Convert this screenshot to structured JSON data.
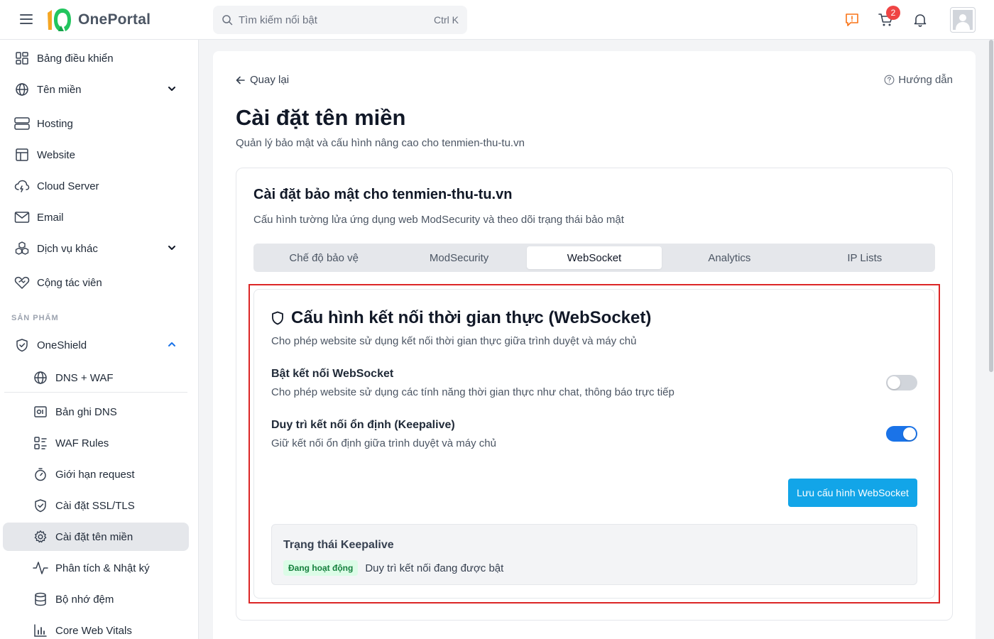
{
  "app": {
    "name": "OnePortal",
    "search_placeholder": "Tìm kiếm nổi bật",
    "search_shortcut": "Ctrl K",
    "cart_count": "2",
    "brand_color": "#12a5e8"
  },
  "sidebar": {
    "items": [
      {
        "label": "Bảng điều khiển",
        "icon": "dashboard-icon"
      },
      {
        "label": "Tên miền",
        "icon": "globe-icon"
      },
      {
        "label": "Hosting",
        "icon": "server-icon"
      },
      {
        "label": "Website",
        "icon": "website-icon"
      },
      {
        "label": "Cloud Server",
        "icon": "cloud-icon"
      },
      {
        "label": "Email",
        "icon": "mail-icon"
      },
      {
        "label": "Dịch vụ khác",
        "icon": "boxes-icon"
      },
      {
        "label": "Cộng tác viên",
        "icon": "handshake-heart-icon"
      }
    ],
    "section_label": "SẢN PHẨM",
    "product": {
      "label": "OneShield",
      "icon": "shield-icon"
    },
    "sub_items": [
      {
        "label": "DNS + WAF",
        "icon": "globe-icon"
      },
      {
        "label": "Bản ghi DNS",
        "icon": "dns-record-icon"
      },
      {
        "label": "WAF Rules",
        "icon": "rules-icon"
      },
      {
        "label": "Giới hạn request",
        "icon": "timer-icon"
      },
      {
        "label": "Cài đặt SSL/TLS",
        "icon": "shield-check-icon"
      },
      {
        "label": "Cài đặt tên miền",
        "icon": "gear-icon"
      },
      {
        "label": "Phân tích & Nhật ký",
        "icon": "activity-icon"
      },
      {
        "label": "Bộ nhớ đệm",
        "icon": "database-icon"
      },
      {
        "label": "Core Web Vitals",
        "icon": "bar-chart-icon"
      }
    ]
  },
  "main": {
    "back_label": "Quay lại",
    "guide_label": "Hướng dẫn",
    "title": "Cài đặt tên miền",
    "subtitle": "Quản lý bảo mật và cấu hình nâng cao cho tenmien-thu-tu.vn",
    "card": {
      "title": "Cài đặt bảo mật cho tenmien-thu-tu.vn",
      "subtitle": "Cấu hình tường lửa ứng dụng web ModSecurity và theo dõi trạng thái bảo mật",
      "tabs": [
        {
          "label": "Chế độ bảo vệ"
        },
        {
          "label": "ModSecurity"
        },
        {
          "label": "WebSocket"
        },
        {
          "label": "Analytics"
        },
        {
          "label": "IP Lists"
        }
      ],
      "active_tab": "WebSocket"
    },
    "websocket": {
      "title": "Cấu hình kết nối thời gian thực (WebSocket)",
      "description": "Cho phép website sử dụng kết nối thời gian thực giữa trình duyệt và máy chủ",
      "settings": [
        {
          "label": "Bật kết nối WebSocket",
          "description": "Cho phép website sử dụng các tính năng thời gian thực như chat, thông báo trực tiếp",
          "enabled": false
        },
        {
          "label": "Duy trì kết nối ổn định (Keepalive)",
          "description": "Giữ kết nối ổn định giữa trình duyệt và máy chủ",
          "enabled": true
        }
      ],
      "save_label": "Lưu cấu hình WebSocket",
      "status": {
        "title": "Trạng thái Keepalive",
        "badge": "Đang hoạt động",
        "text": "Duy trì kết nối đang được bật"
      }
    }
  }
}
